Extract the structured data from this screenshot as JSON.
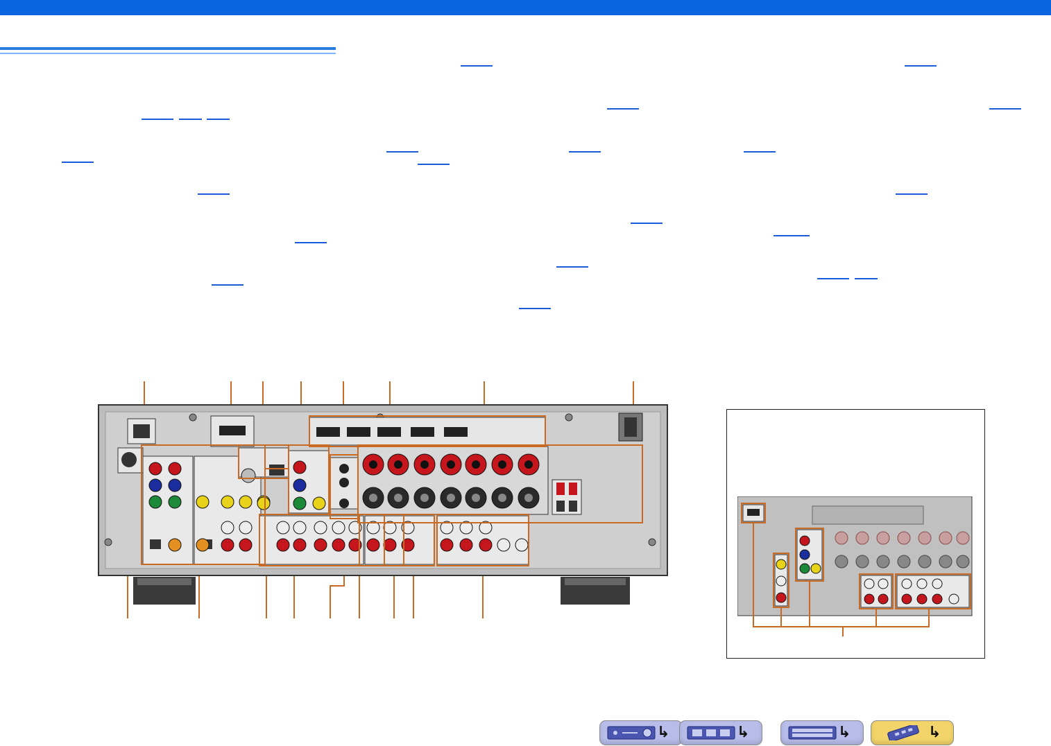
{
  "header": {
    "bar_color": "#0a66e0"
  },
  "page": {
    "title_rule_color": "#2a7de0",
    "link_color": "#1a5bd8"
  },
  "diagram": {
    "leader_color": "#c86a24",
    "panel_color": "#c9c9c9",
    "jack_colors": {
      "red": "#c4161c",
      "blue": "#1c2e9e",
      "green": "#1d8a3a",
      "yellow": "#e8d21a",
      "white": "#ededed",
      "black": "#2a2a2a"
    }
  },
  "nav_buttons": [
    {
      "icon": "receiver-front-icon",
      "arrow": "↳",
      "color": "#b7bde8"
    },
    {
      "icon": "front-panel-display-icon",
      "arrow": "↳",
      "color": "#b7bde8"
    },
    {
      "icon": "rear-panel-icon",
      "arrow": "↳",
      "color": "#b7bde8"
    },
    {
      "icon": "remote-control-icon",
      "arrow": "↳",
      "color": "#f2d46a"
    }
  ]
}
